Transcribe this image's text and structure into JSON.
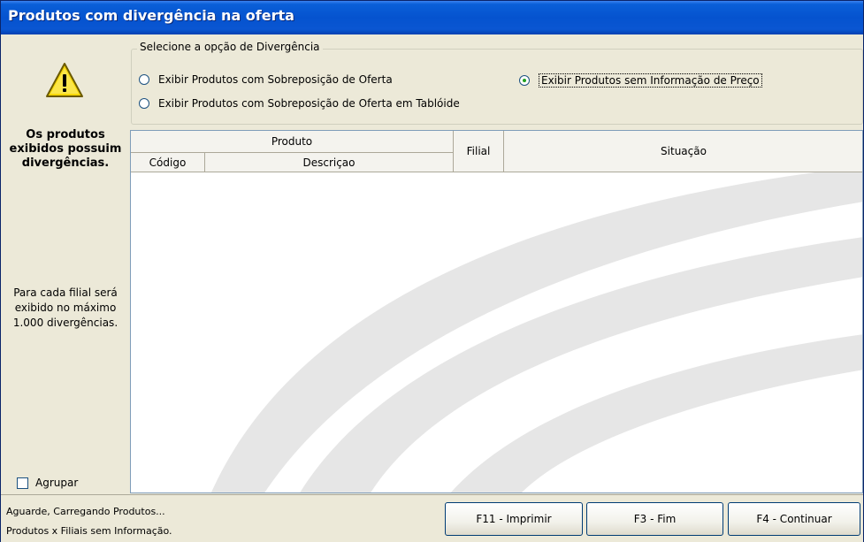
{
  "window": {
    "title": "Produtos com divergência na oferta"
  },
  "left_panel": {
    "icon": "warning-icon",
    "warning_text": "Os produtos exibidos possuim divergências.",
    "info_text": "Para cada filial será exibido no máximo 1.000 divergências.",
    "agrupar_label": "Agrupar",
    "agrupar_checked": false
  },
  "divergence_group": {
    "legend": "Selecione a opção de Divergência",
    "options": [
      {
        "label": "Exibir Produtos com Sobreposição de Oferta",
        "selected": false
      },
      {
        "label": "Exibir Produtos com Sobreposição de Oferta em Tablóide",
        "selected": false
      },
      {
        "label": "Exibir Produtos sem Informação de Preço",
        "selected": true
      }
    ]
  },
  "grid": {
    "group_header": "Produto",
    "columns": [
      "Código",
      "Descriçao",
      "Filial",
      "Situação"
    ],
    "rows": []
  },
  "status": {
    "line1": "Aguarde, Carregando Produtos...",
    "line2": "Produtos x Filiais sem Informação."
  },
  "buttons": {
    "print": "F11 - Imprimir",
    "end": "F3 - Fim",
    "continue": "F4 - Continuar"
  },
  "colors": {
    "titlebar": "#0553cf",
    "face": "#ece9d8",
    "radio_dot": "#21a121"
  }
}
